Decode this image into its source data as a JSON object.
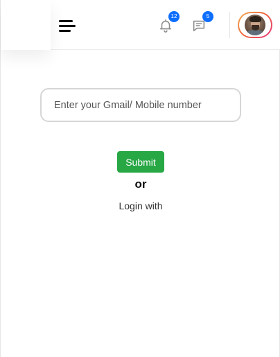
{
  "header": {
    "menu_icon": "hamburger-menu-icon",
    "notifications": {
      "icon": "bell-icon",
      "count": "12",
      "badge_color": "#0d6efd"
    },
    "messages": {
      "icon": "chat-icon",
      "count": "5",
      "badge_color": "#0d6efd"
    },
    "avatar": {
      "icon": "user-avatar",
      "ring_colors": [
        "#f0b058",
        "#ee6a3b",
        "#e8337c"
      ]
    }
  },
  "login": {
    "input_placeholder": "Enter your Gmail/ Mobile number",
    "input_value": "",
    "submit_label": "Submit",
    "submit_color": "#28a745",
    "or_label": "or",
    "login_with_label": "Login with"
  }
}
